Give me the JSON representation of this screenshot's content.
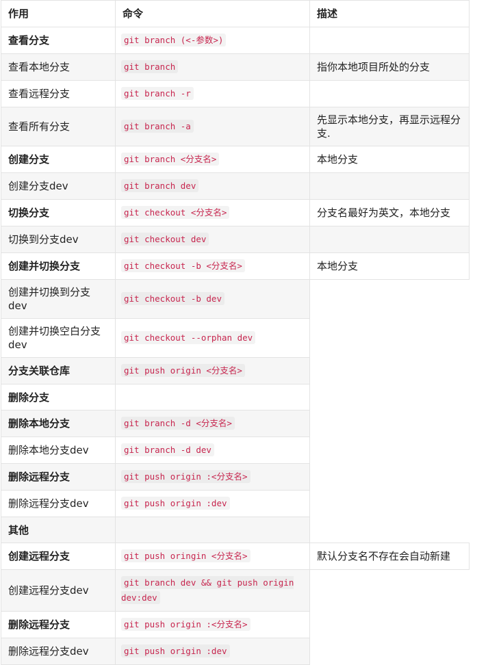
{
  "headers": [
    "作用",
    "命令",
    "描述"
  ],
  "rows": [
    {
      "action": "查看分支",
      "command": "git branch  (<-参数>)",
      "desc": "",
      "bold": true
    },
    {
      "action": "查看本地分支",
      "command": "git branch",
      "desc": "指你本地项目所处的分支",
      "bold": false
    },
    {
      "action": "查看远程分支",
      "command": "git branch -r",
      "desc": "",
      "bold": false
    },
    {
      "action": "查看所有分支",
      "command": "git branch -a",
      "desc": "先显示本地分支，再显示远程分支.",
      "bold": false
    },
    {
      "action": "创建分支",
      "command": "git branch <分支名>",
      "desc": "本地分支",
      "bold": true
    },
    {
      "action": "创建分支dev",
      "command": "git branch dev",
      "desc": "",
      "bold": false
    },
    {
      "action": "切换分支",
      "command": "git checkout <分支名>",
      "desc": "分支名最好为英文，本地分支",
      "bold": true
    },
    {
      "action": "切换到分支dev",
      "command": "git checkout dev",
      "desc": "",
      "bold": false
    },
    {
      "action": "创建并切换分支",
      "command": "git checkout -b <分支名>",
      "desc": "本地分支",
      "bold": true
    },
    {
      "action": "创建并切换到分支dev",
      "command": "git checkout -b dev",
      "desc": "",
      "bold": false
    },
    {
      "action": "创建并切换空白分支dev",
      "command": "git checkout --orphan dev",
      "desc": "",
      "bold": false
    },
    {
      "action": "分支关联仓库",
      "command": "git push origin <分支名>",
      "desc": "",
      "bold": true
    },
    {
      "action": "删除分支",
      "command": "",
      "desc": "",
      "bold": true
    },
    {
      "action": "删除本地分支",
      "command": "git branch -d <分支名>",
      "desc": "",
      "bold": true
    },
    {
      "action": "删除本地分支dev",
      "command": "git branch -d dev",
      "desc": "",
      "bold": false
    },
    {
      "action": "删除远程分支",
      "command": "git push origin :<分支名>",
      "desc": "",
      "bold": true
    },
    {
      "action": "删除远程分支dev",
      "command": "git push origin :dev",
      "desc": "",
      "bold": false
    },
    {
      "action": "其他",
      "command": "",
      "desc": "",
      "bold": true
    },
    {
      "action": "创建远程分支",
      "command": "git push oringin <分支名>",
      "desc": "默认分支名不存在会自动新建",
      "bold": true
    },
    {
      "action": "创建远程分支dev",
      "command": "git branch dev && git push origin dev:dev",
      "desc": "",
      "bold": false
    },
    {
      "action": "删除远程分支",
      "command": "git push origin :<分支名>",
      "desc": "",
      "bold": true
    },
    {
      "action": "删除远程分支dev",
      "command": "git push origin :dev",
      "desc": "",
      "bold": false
    }
  ]
}
